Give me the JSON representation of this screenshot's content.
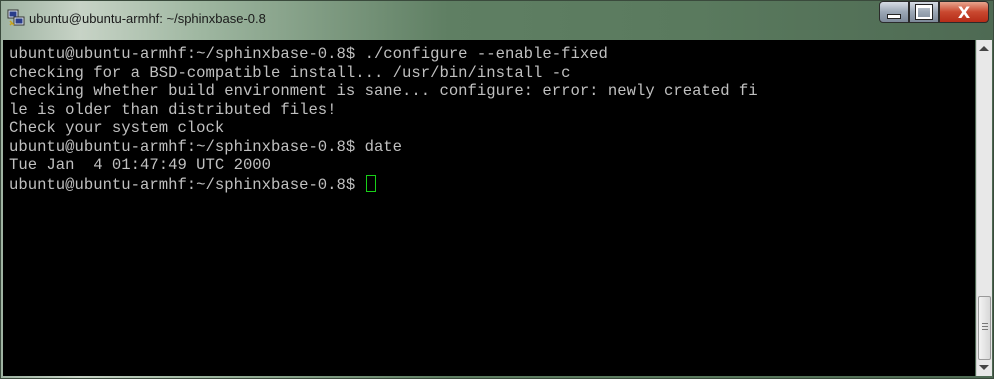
{
  "window": {
    "title": "ubuntu@ubuntu-armhf: ~/sphinxbase-0.8",
    "close_glyph": "X"
  },
  "terminal": {
    "lines": [
      "ubuntu@ubuntu-armhf:~/sphinxbase-0.8$ ./configure --enable-fixed",
      "checking for a BSD-compatible install... /usr/bin/install -c",
      "checking whether build environment is sane... configure: error: newly created fi",
      "le is older than distributed files!",
      "Check your system clock",
      "ubuntu@ubuntu-armhf:~/sphinxbase-0.8$ date",
      "Tue Jan  4 01:47:49 UTC 2000",
      "ubuntu@ubuntu-armhf:~/sphinxbase-0.8$ "
    ],
    "cursor_color": "#18d018",
    "text_color": "#c0c0c0",
    "background": "#000000"
  },
  "icons": {
    "app": "putty-icon",
    "minimize": "minimize-icon",
    "maximize": "maximize-icon",
    "close": "close-icon",
    "scroll_up": "scroll-up-arrow-icon",
    "scroll_down": "scroll-down-arrow-icon"
  }
}
